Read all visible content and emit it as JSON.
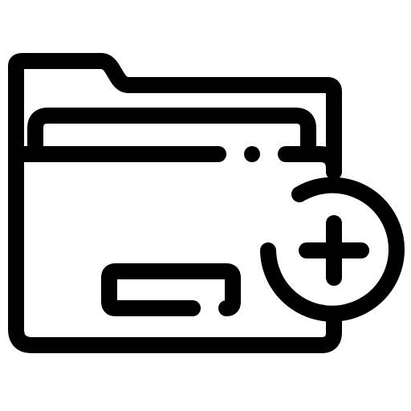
{
  "icon": {
    "name": "add-folder-icon",
    "colors": {
      "stroke": "#000000",
      "background": "#ffffff"
    },
    "parts": [
      "folder-back-icon",
      "folder-inner-sheet-icon",
      "folder-front-icon",
      "folder-label-slot-icon",
      "add-badge-circle-icon",
      "plus-sign-icon"
    ]
  }
}
